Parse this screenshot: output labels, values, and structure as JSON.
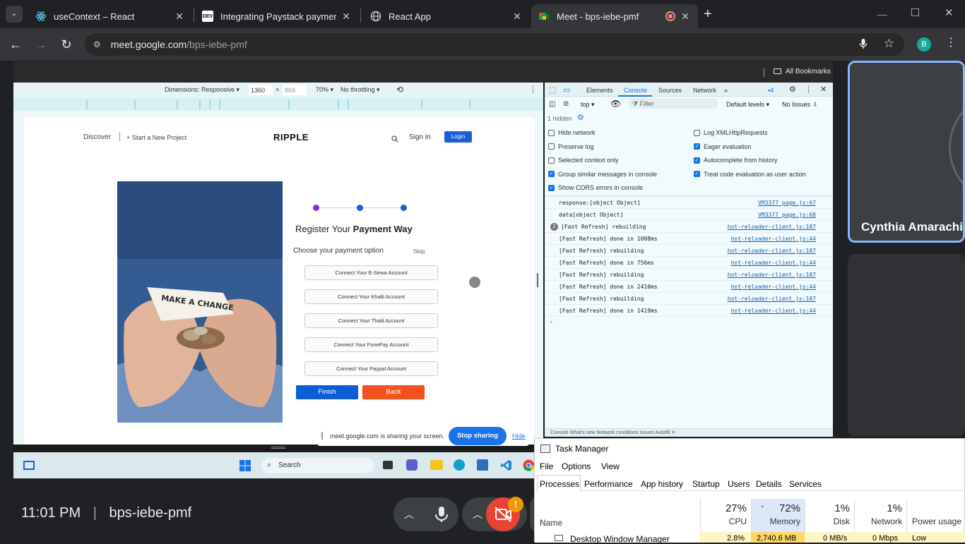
{
  "tabs": [
    {
      "title": "useContext – React",
      "icon": "react-icon"
    },
    {
      "title": "Integrating Paystack payments",
      "icon": "dev-icon"
    },
    {
      "title": "React App",
      "icon": "globe-icon"
    },
    {
      "title": "Meet - bps-iebe-pmf",
      "icon": "meet-icon"
    }
  ],
  "address": {
    "host": "meet.google.com",
    "path": "/bps-iebe-pmf"
  },
  "profile_initial": "B",
  "bookmarks_label": "All Bookmarks",
  "devbar": {
    "dimensions": "Dimensions: Responsive ▾",
    "width": "1360",
    "times": "×",
    "height": "869",
    "zoom": "70% ▾",
    "throttle": "No throttling ▾"
  },
  "site": {
    "discover": "Discover",
    "start_project": "+ Start a New Project",
    "logo": "RIPPLE",
    "sign_in": "Sign in",
    "login": "Login",
    "hero_text": "MAKE A CHANGE",
    "register_prefix": "Register Your ",
    "register_bold": "Payment Way",
    "choose_label": "Choose your payment option",
    "skip": "Skip",
    "buttons": [
      "Connect Your E-Sewa Account",
      "Connect Your Khalti Account",
      "Connect Your Thaili Account",
      "Connect Your FonePay Account",
      "Connect Your Paypal Account"
    ],
    "finish": "Finish",
    "back": "Back"
  },
  "devtools": {
    "tabs": [
      "Elements",
      "Console",
      "Sources",
      "Network"
    ],
    "issues_count": "4",
    "context": "top ▾",
    "filter_placeholder": "Filter",
    "levels": "Default levels ▾",
    "no_issues": "No Issues",
    "no_issues_count": "4",
    "hidden": "1 hidden",
    "settings_left": [
      {
        "label": "Hide network",
        "checked": false
      },
      {
        "label": "Preserve log",
        "checked": false
      },
      {
        "label": "Selected context only",
        "checked": false
      },
      {
        "label": "Group similar messages in console",
        "checked": true
      },
      {
        "label": "Show CORS errors in console",
        "checked": true
      }
    ],
    "settings_right": [
      {
        "label": "Log XMLHttpRequests",
        "checked": false
      },
      {
        "label": "Eager evaluation",
        "checked": true
      },
      {
        "label": "Autocomplete from history",
        "checked": true
      },
      {
        "label": "Treat code evaluation as user action",
        "checked": true
      }
    ],
    "logs": [
      {
        "msg": "response:[object Object]",
        "src": "VM3377 page.js:67"
      },
      {
        "msg": "data[object Object]",
        "src": "VM3377 page.js:68"
      },
      {
        "msg": "[Fast Refresh] rebuilding",
        "src": "hot-reloader-client.js:187",
        "count": "2"
      },
      {
        "msg": "[Fast Refresh] done in 1008ms",
        "src": "hot-reloader-client.js:44"
      },
      {
        "msg": "[Fast Refresh] rebuilding",
        "src": "hot-reloader-client.js:187"
      },
      {
        "msg": "[Fast Refresh] done in 756ms",
        "src": "hot-reloader-client.js:44"
      },
      {
        "msg": "[Fast Refresh] rebuilding",
        "src": "hot-reloader-client.js:187"
      },
      {
        "msg": "[Fast Refresh] done in 2410ms",
        "src": "hot-reloader-client.js:44"
      },
      {
        "msg": "[Fast Refresh] rebuilding",
        "src": "hot-reloader-client.js:187"
      },
      {
        "msg": "[Fast Refresh] done in 1419ms",
        "src": "hot-reloader-client.js:44"
      }
    ],
    "prompt": "›",
    "drawer_tabs": "Console   What's new   Network conditions   Issues   Autofill ✕"
  },
  "sharing": {
    "text": "meet.google.com is sharing your screen.",
    "stop": "Stop sharing",
    "hide": "Hide"
  },
  "taskbar_search": "Search",
  "participant": "Cynthia Amarachi",
  "meeting": {
    "time": "11:01 PM",
    "separator": "|",
    "code": "bps-iebe-pmf"
  },
  "alert_badge": "!",
  "task_manager": {
    "title": "Task Manager",
    "menu": [
      "File",
      "Options",
      "View"
    ],
    "tabs": [
      "Processes",
      "Performance",
      "App history",
      "Startup",
      "Users",
      "Details",
      "Services"
    ],
    "name_col": "Name",
    "columns": [
      {
        "pct": "27%",
        "label": "CPU"
      },
      {
        "pct": "72%",
        "label": "Memory"
      },
      {
        "pct": "1%",
        "label": "Disk"
      },
      {
        "pct": "1%",
        "label": "Network"
      },
      {
        "pct": "",
        "label": "Power usage"
      }
    ],
    "row": {
      "name": "Desktop Window Manager",
      "cpu": "2.8%",
      "memory": "2,740.6 MB",
      "disk": "0 MB/s",
      "network": "0 Mbps",
      "power": "Low"
    }
  },
  "colors": {
    "accent": "#1a73e8",
    "finish": "#0b5ed7",
    "back": "#f4511e",
    "meet_bg": "#202124",
    "alert": "#f29900"
  }
}
